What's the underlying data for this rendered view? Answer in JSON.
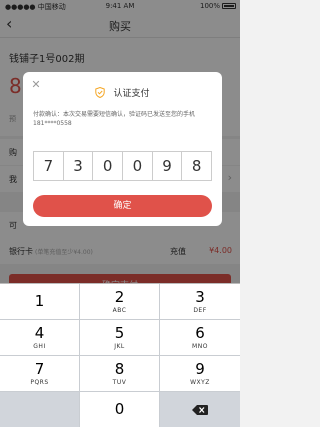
{
  "status_bar": {
    "carrier": "●●●●● 中国移动 ",
    "time": "9:41 AM",
    "battery": "100%"
  },
  "nav": {
    "back": "‹",
    "title": "购买"
  },
  "product": {
    "name": "钱铺子1号002期",
    "amount_partial": "8",
    "pre_label_partial": "预"
  },
  "rows": {
    "row1_label_partial": "购",
    "row2_label_partial": "我",
    "row3_label_partial": "可",
    "bank": {
      "label": "银行卡",
      "hint": "(单笔充值至少¥4.00)",
      "recharge_label": "充值",
      "recharge_amount": "¥4.00"
    }
  },
  "pay_button_partial": "确定支付",
  "dialog": {
    "title": "认证支付",
    "message": "付款确认：本次交易需要短信确认，验证码已发送至您的手机 181****0558",
    "code": [
      "7",
      "3",
      "0",
      "0",
      "9",
      "8"
    ],
    "confirm_label": "确定"
  },
  "keyboard": {
    "keys": [
      {
        "num": "1",
        "letters": ""
      },
      {
        "num": "2",
        "letters": "ABC"
      },
      {
        "num": "3",
        "letters": "DEF"
      },
      {
        "num": "4",
        "letters": "GHI"
      },
      {
        "num": "5",
        "letters": "JKL"
      },
      {
        "num": "6",
        "letters": "MNO"
      },
      {
        "num": "7",
        "letters": "PQRS"
      },
      {
        "num": "8",
        "letters": "TUV"
      },
      {
        "num": "9",
        "letters": "WXYZ"
      },
      {
        "num": "0",
        "letters": ""
      }
    ],
    "delete_icon": "backspace-icon"
  },
  "colors": {
    "accent": "#e0524a",
    "shield": "#f5a623"
  }
}
